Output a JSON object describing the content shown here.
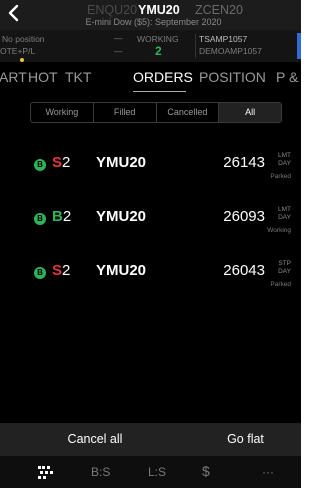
{
  "header": {
    "symbol_left": "ENQU20",
    "symbol_center": "YMU20",
    "symbol_right": "ZCEN20",
    "subtitle": "E-mini Dow ($5): September 2020"
  },
  "status_bar": {
    "position_label": "No position",
    "ote_label": "OTE+P/L",
    "dash1": "—",
    "dash2": "—",
    "working_label": "WORKING",
    "working_count": "2",
    "account1": "TSAMP1057",
    "account2": "DEMOAMP1057"
  },
  "tabs": [
    "ART",
    "HOT",
    "TKT",
    "ORDERS",
    "POSITION",
    "P &"
  ],
  "active_tab": "ORDERS",
  "filters": [
    "Working",
    "Filled",
    "Cancelled",
    "All"
  ],
  "active_filter": "All",
  "orders": [
    {
      "badge": "B",
      "side": "S",
      "qty": "2",
      "contract": "YMU20",
      "price": "26143",
      "type": "LMT",
      "duration": "DAY",
      "status": "Parked"
    },
    {
      "badge": "B",
      "side": "B",
      "qty": "2",
      "contract": "YMU20",
      "price": "26093",
      "type": "LMT",
      "duration": "DAY",
      "status": "Working"
    },
    {
      "badge": "B",
      "side": "S",
      "qty": "2",
      "contract": "YMU20",
      "price": "26043",
      "type": "STP",
      "duration": "DAY",
      "status": "Parked"
    }
  ],
  "footer": {
    "cancel_all": "Cancel all",
    "go_flat": "Go flat"
  },
  "nav": {
    "bs": "B:S",
    "ls": "L:S",
    "dollar": "$",
    "more": "···"
  },
  "colors": {
    "buy_green": "#2fb35a",
    "sell_red": "#e0353d",
    "background": "#000000"
  }
}
